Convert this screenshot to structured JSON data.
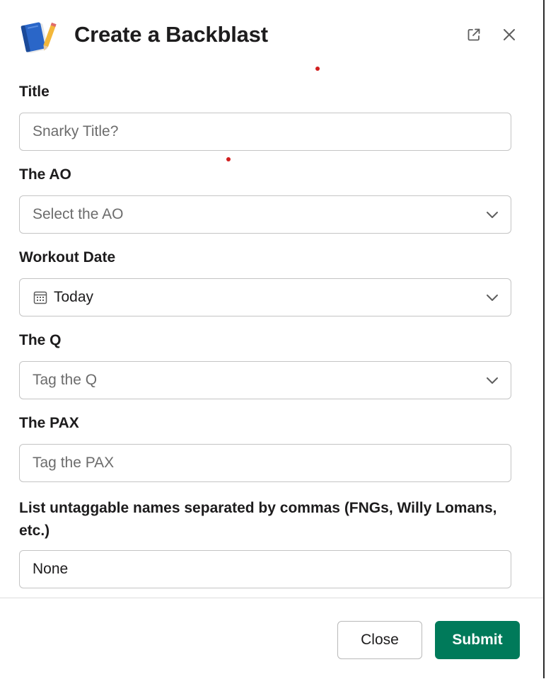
{
  "modal": {
    "title": "Create a Backblast",
    "app_icon": "notebook-icon",
    "header_icons": [
      "external-link-icon",
      "close-icon"
    ]
  },
  "form": {
    "title_field": {
      "label": "Title",
      "placeholder": "Snarky Title?"
    },
    "ao_field": {
      "label": "The AO",
      "placeholder": "Select the AO"
    },
    "date_field": {
      "label": "Workout Date",
      "value": "Today"
    },
    "q_field": {
      "label": "The Q",
      "placeholder": "Tag the Q"
    },
    "pax_field": {
      "label": "The PAX",
      "placeholder": "Tag the PAX"
    },
    "untaggable_field": {
      "label": "List untaggable names separated by commas (FNGs, Willy Lomans, etc.)",
      "value": "None"
    }
  },
  "footer": {
    "close_label": "Close",
    "submit_label": "Submit"
  },
  "colors": {
    "submit_bg": "#007a5a",
    "annotation_dot": "#d11f1f"
  }
}
